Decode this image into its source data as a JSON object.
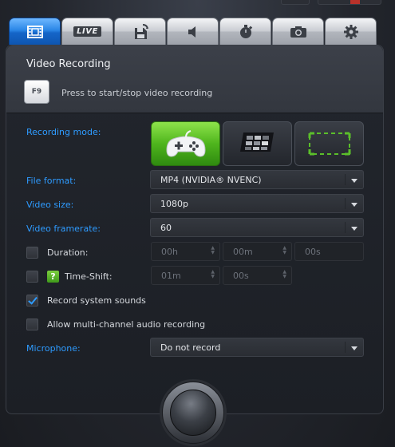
{
  "tabs": [
    {
      "name": "video-tab",
      "icon": "film-icon",
      "active": true
    },
    {
      "name": "live-tab",
      "label": "LIVE",
      "active": false
    },
    {
      "name": "save-tab",
      "icon": "save-icon",
      "active": false
    },
    {
      "name": "audio-tab",
      "icon": "speaker-icon",
      "active": false
    },
    {
      "name": "timer-tab",
      "icon": "stopwatch-icon",
      "active": false
    },
    {
      "name": "screenshot-tab",
      "icon": "camera-icon",
      "active": false
    },
    {
      "name": "settings-tab",
      "icon": "gear-icon",
      "active": false
    }
  ],
  "panel": {
    "title": "Video Recording",
    "hotkey_label": "F9",
    "hotkey_hint": "Press to start/stop video recording"
  },
  "labels": {
    "recording_mode": "Recording mode:",
    "file_format": "File format:",
    "video_size": "Video size:",
    "video_framerate": "Video framerate:",
    "duration": "Duration:",
    "time_shift": "Time-Shift:",
    "record_system_sounds": "Record system sounds",
    "multichannel": "Allow multi-channel audio recording",
    "microphone": "Microphone:"
  },
  "recording_modes": [
    {
      "name": "game-mode",
      "icon": "gamepad-icon",
      "active": true
    },
    {
      "name": "fullscreen-mode",
      "icon": "monitor-icon",
      "active": false
    },
    {
      "name": "region-mode",
      "icon": "region-select-icon",
      "active": false
    }
  ],
  "values": {
    "file_format": "MP4 (NVIDIA® NVENC)",
    "video_size": "1080p",
    "video_framerate": "60",
    "microphone": "Do not record",
    "duration_h": "00h",
    "duration_m": "00m",
    "duration_s": "00s",
    "timeshift_m": "01m",
    "timeshift_s": "00s",
    "help_glyph": "?"
  },
  "checkboxes": {
    "duration": false,
    "time_shift": false,
    "record_system_sounds": true,
    "multichannel": false
  },
  "colors": {
    "accent_blue": "#2e9bff",
    "active_tab": "#1e78dc",
    "active_mode_green": "#4fb51d"
  }
}
